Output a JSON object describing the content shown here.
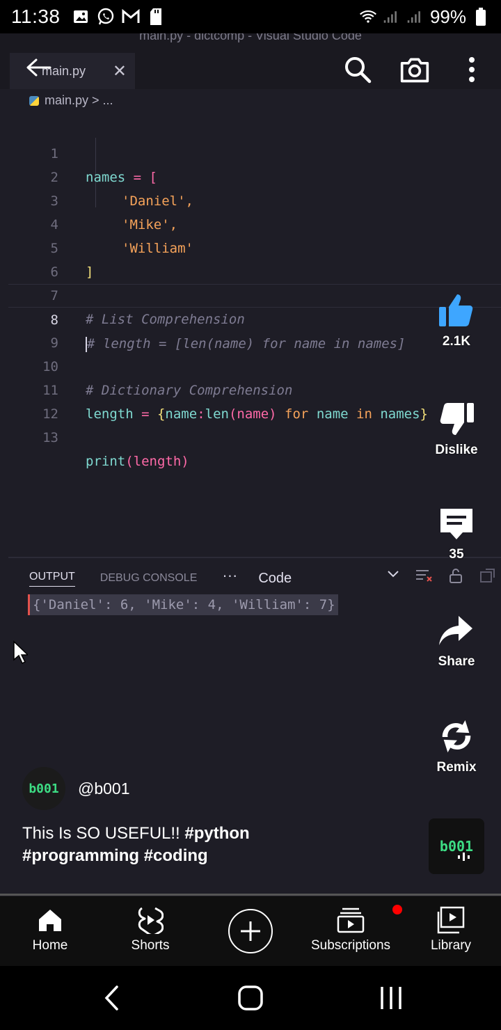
{
  "status_bar": {
    "time": "11:38",
    "battery": "99%"
  },
  "vscode": {
    "window_title": "main.py - dictcomp - Visual Studio Code",
    "tab_label": "main.py",
    "breadcrumb": "main.py > ...",
    "code_lines": [
      {
        "n": "1"
      },
      {
        "n": "2"
      },
      {
        "n": "3"
      },
      {
        "n": "4"
      },
      {
        "n": "5"
      },
      {
        "n": "6"
      },
      {
        "n": "7"
      },
      {
        "n": "8"
      },
      {
        "n": "9"
      },
      {
        "n": "10"
      },
      {
        "n": "11"
      },
      {
        "n": "12"
      },
      {
        "n": "13"
      }
    ],
    "code": {
      "l1_var": "names",
      "l1_op": " = [",
      "l2": "'Daniel',",
      "l3": "'Mike',",
      "l4": "'William'",
      "l5": "]",
      "l7": "# List Comprehension",
      "l8": "# length = [len(name) for name in names]",
      "l10": "# Dictionary Comprehension",
      "l11_var": "length",
      "l11_eq": " = ",
      "l11_open": "{",
      "l11_name": "name",
      "l11_colon": ":",
      "l11_len": "len",
      "l11_args": "(name)",
      "l11_for": " for ",
      "l11_name2": "name",
      "l11_in": " in ",
      "l11_names": "names",
      "l11_close": "}",
      "l13_fn": "print",
      "l13_args": "(length)"
    },
    "panel": {
      "tab_output": "OUTPUT",
      "tab_debug": "DEBUG CONSOLE",
      "more": "···",
      "selected_channel": "Code",
      "output_text": "{'Daniel': 6, 'Mike': 4, 'William': 7}"
    }
  },
  "shorts": {
    "like_count": "2.1K",
    "dislike_label": "Dislike",
    "comment_count": "35",
    "share_label": "Share",
    "remix_label": "Remix",
    "channel_handle": "@b001",
    "avatar_text": "b001",
    "caption_text": "This Is SO USEFUL!! ",
    "caption_tags": [
      "#python",
      "#programming",
      "#coding"
    ],
    "progress": 0.0
  },
  "bottom_nav": {
    "items": [
      {
        "label": "Home"
      },
      {
        "label": "Shorts"
      },
      {
        "label": "Subscriptions"
      },
      {
        "label": "Library"
      }
    ]
  },
  "colors": {
    "like_blue": "#3ea6ff",
    "notification_red": "#ff0000",
    "channel_green": "#3ddc84"
  }
}
